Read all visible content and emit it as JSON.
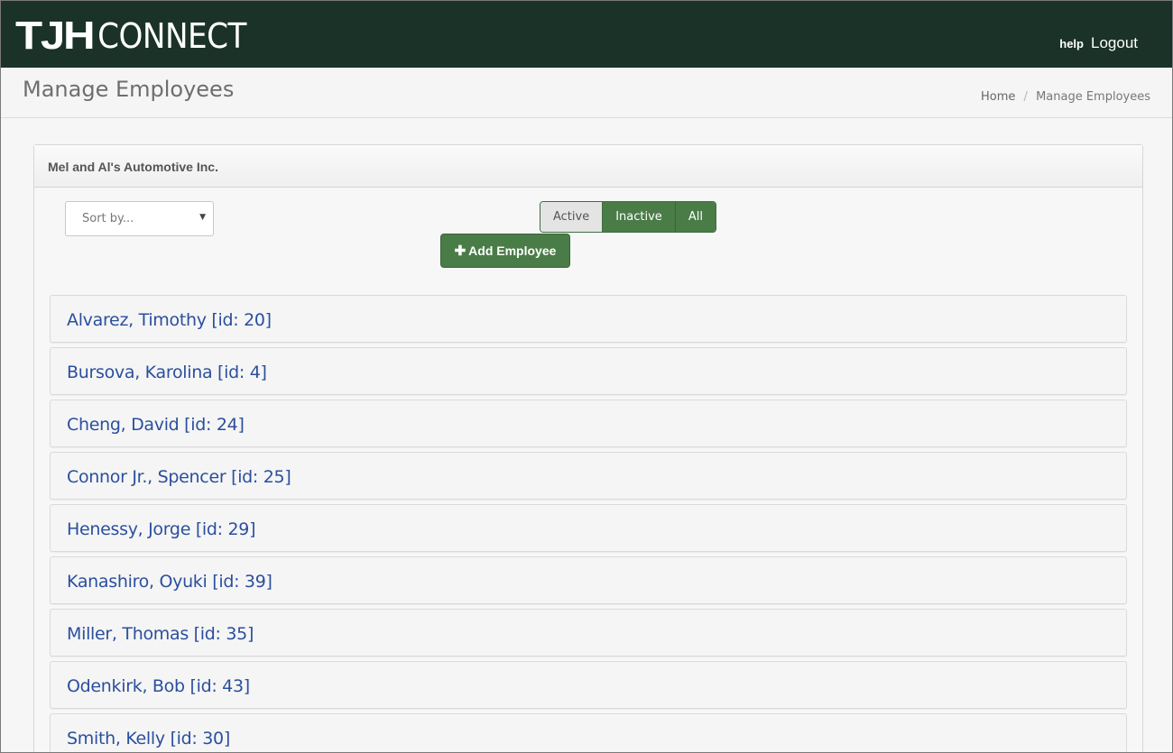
{
  "brand": {
    "logo_bold": "TJH",
    "logo_thin": "CONNECT"
  },
  "topnav": {
    "help": "help",
    "logout": "Logout"
  },
  "page": {
    "title": "Manage Employees"
  },
  "breadcrumb": {
    "home": "Home",
    "current": "Manage Employees",
    "separator": "/"
  },
  "panel": {
    "company": "Mel and Al's Automotive Inc."
  },
  "controls": {
    "sort_placeholder": "Sort by...",
    "filters": [
      "Active",
      "Inactive",
      "All"
    ],
    "selected_filter": "Active",
    "add_button": "Add Employee"
  },
  "employees": [
    "Alvarez, Timothy [id: 20]",
    "Bursova, Karolina [id: 4]",
    "Cheng, David [id: 24]",
    "Connor Jr., Spencer [id: 25]",
    "Henessy, Jorge [id: 29]",
    "Kanashiro, Oyuki [id: 39]",
    "Miller, Thomas [id: 35]",
    "Odenkirk, Bob [id: 43]",
    "Smith, Kelly [id: 30]"
  ],
  "colors": {
    "topbar": "#1a3228",
    "primary_green": "#4a7c47",
    "link_blue": "#2a4f9e"
  }
}
